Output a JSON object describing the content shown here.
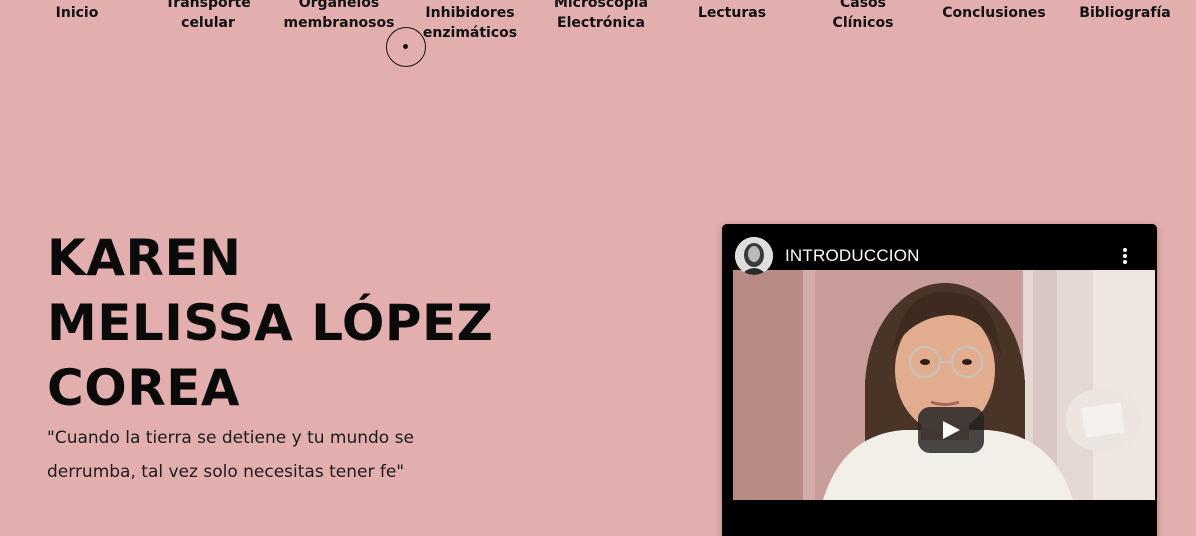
{
  "nav": {
    "items": [
      {
        "lines": [
          "Inicio"
        ]
      },
      {
        "lines": [
          "Transporte",
          "celular"
        ]
      },
      {
        "lines": [
          "Organelos",
          "membranosos"
        ]
      },
      {
        "lines": [
          "Inhibidores",
          "enzimáticos"
        ]
      },
      {
        "lines": [
          "Microscopía",
          "Electrónica"
        ]
      },
      {
        "lines": [
          "Lecturas"
        ]
      },
      {
        "lines": [
          "Casos",
          "Clínicos"
        ]
      },
      {
        "lines": [
          "Conclusiones"
        ]
      },
      {
        "lines": [
          "Bibliografía"
        ]
      }
    ]
  },
  "hero": {
    "name_lines": [
      "KAREN",
      "MELISSA LÓPEZ",
      "COREA"
    ],
    "quote": "\"Cuando la tierra se detiene y tu mundo se derrumba, tal vez solo necesitas tener fe\""
  },
  "video": {
    "title": "INTRODUCCION",
    "icons": {
      "menu": "more-vertical-icon",
      "play": "play-icon",
      "avatar": "channel-avatar"
    }
  },
  "colors": {
    "background": "#e2aeae",
    "text": "#0d0d0d",
    "video_bg": "#000000"
  }
}
